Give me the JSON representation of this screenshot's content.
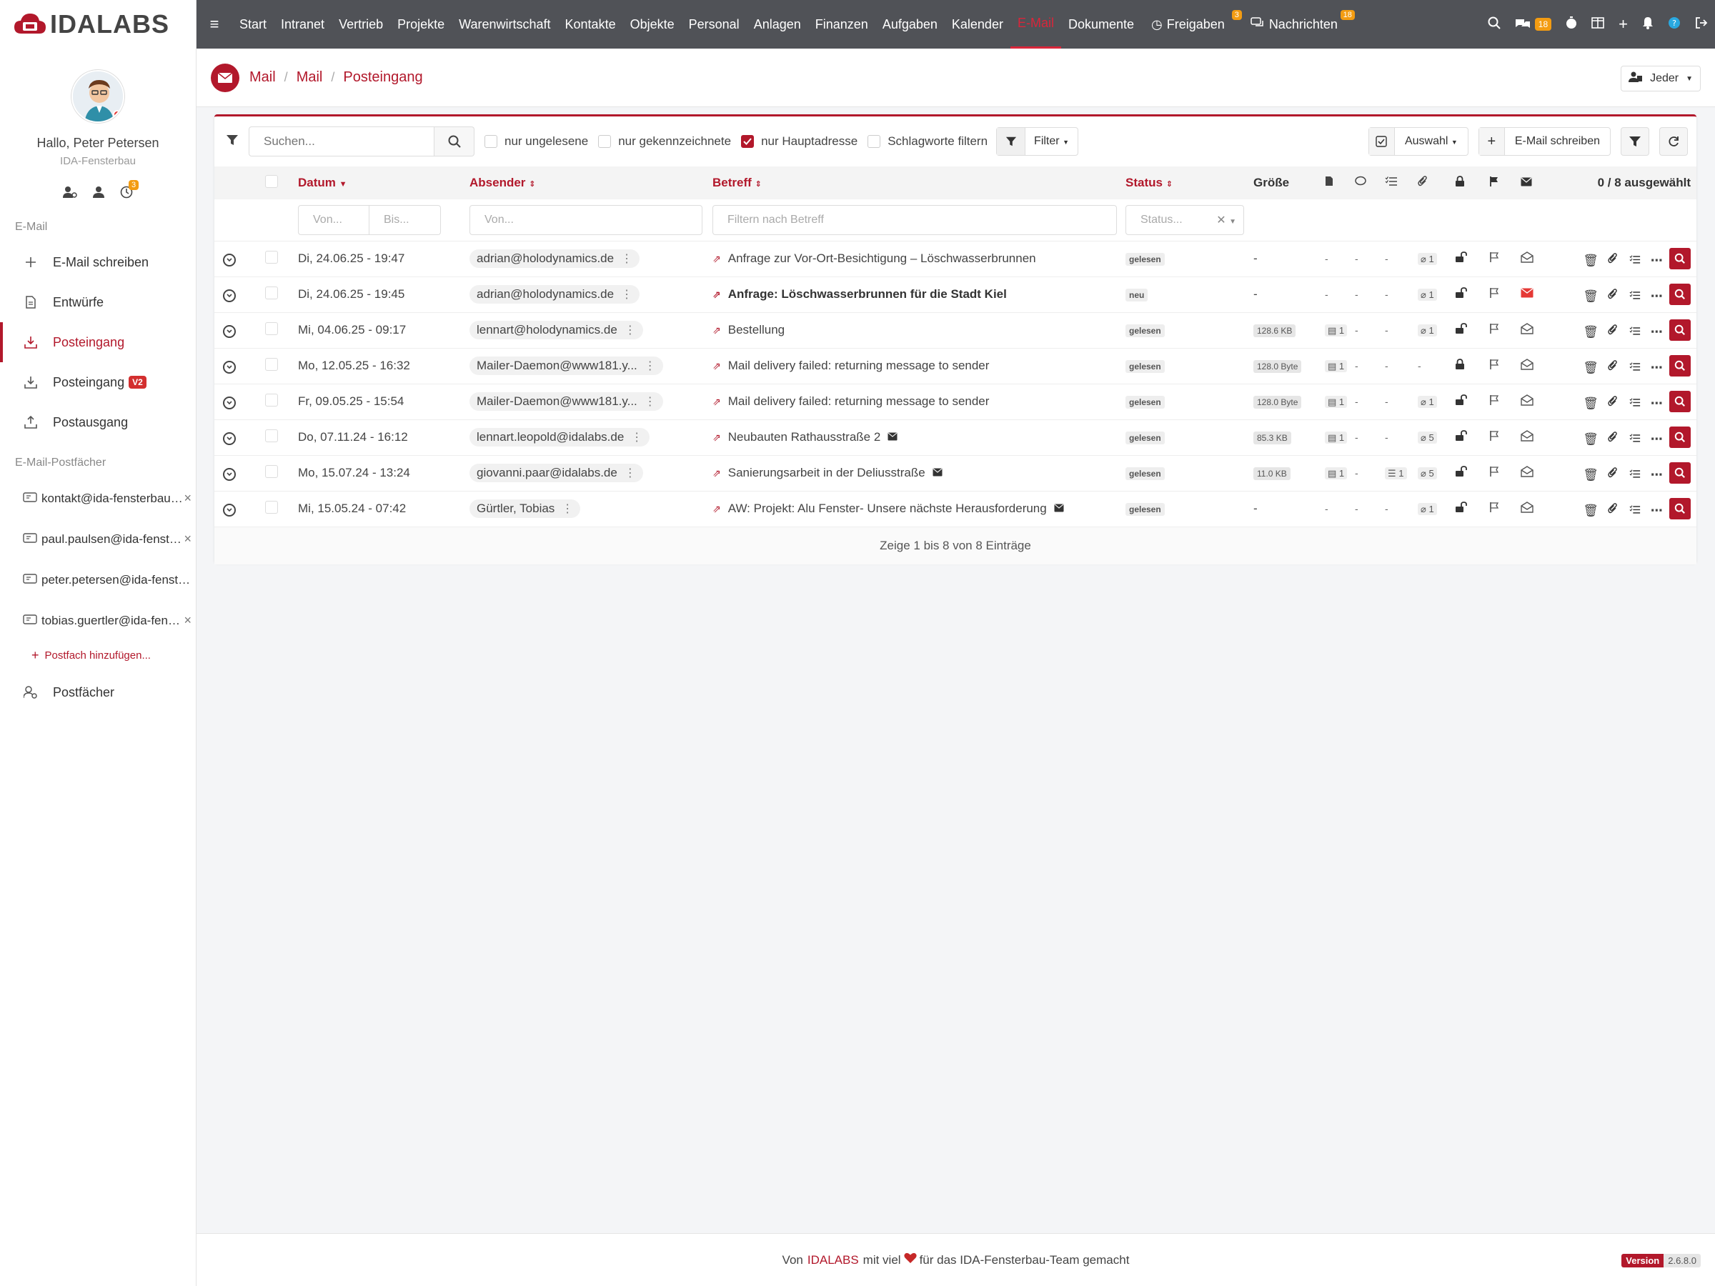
{
  "brand": {
    "name": "IDALABS"
  },
  "profile": {
    "greeting": "Hallo, Peter Petersen",
    "company": "IDA-Fensterbau",
    "notif_count": "3"
  },
  "sidebar": {
    "section_email": "E-Mail",
    "items": [
      {
        "label": "E-Mail schreiben"
      },
      {
        "label": "Entwürfe"
      },
      {
        "label": "Posteingang"
      },
      {
        "label": "Posteingang",
        "badge": "V2"
      },
      {
        "label": "Postausgang"
      }
    ],
    "section_mailboxes": "E-Mail-Postfächer",
    "mailboxes": [
      {
        "label": "kontakt@ida-fensterbau.de"
      },
      {
        "label": "paul.paulsen@ida-fensterbau.de"
      },
      {
        "label": "peter.petersen@ida-fensterbau.de"
      },
      {
        "label": "tobias.guertler@ida-fensterbau.de"
      }
    ],
    "add_mailbox": "Postfach hinzufügen...",
    "postfaecher": "Postfächer"
  },
  "nav": {
    "items": [
      "Start",
      "Intranet",
      "Vertrieb",
      "Projekte",
      "Warenwirtschaft",
      "Kontakte",
      "Objekte",
      "Personal",
      "Anlagen",
      "Finanzen",
      "Aufgaben",
      "Kalender",
      "E-Mail",
      "Dokumente"
    ],
    "freigaben": "Freigaben",
    "freigaben_badge": "3",
    "nachrichten": "Nachrichten",
    "nachrichten_badge": "18",
    "chat_badge": "18"
  },
  "breadcrumb": [
    "Mail",
    "Mail",
    "Posteingang"
  ],
  "jeder": "Jeder",
  "toolbar": {
    "search_placeholder": "Suchen...",
    "cb_unread": "nur ungelesene",
    "cb_flagged": "nur gekennzeichnete",
    "cb_main": "nur Hauptadresse",
    "cb_tags": "Schlagworte filtern",
    "filter": "Filter",
    "auswahl": "Auswahl",
    "compose": "E-Mail schreiben"
  },
  "table": {
    "headers": {
      "datum": "Datum",
      "absender": "Absender",
      "betreff": "Betreff",
      "status": "Status",
      "groesse": "Größe",
      "selected": "0 / 8 ausgewählt"
    },
    "filters": {
      "von": "Von...",
      "bis": "Bis...",
      "absender": "Von...",
      "betreff": "Filtern nach Betreff",
      "status": "Status..."
    },
    "rows": [
      {
        "date": "Di, 24.06.25 - 19:47",
        "sender": "adrian@holodynamics.de",
        "subject": "Anfrage zur Vor-Ort-Besichtigung – Löschwasserbrunnen",
        "status": "gelesen",
        "size": "-",
        "docs": "-",
        "comments": "-",
        "tasks": "-",
        "att": "1",
        "bold": false
      },
      {
        "date": "Di, 24.06.25 - 19:45",
        "sender": "adrian@holodynamics.de",
        "subject": "Anfrage: Löschwasserbrunnen für die Stadt Kiel",
        "status": "neu",
        "size": "-",
        "docs": "-",
        "comments": "-",
        "tasks": "-",
        "att": "1",
        "bold": true
      },
      {
        "date": "Mi, 04.06.25 - 09:17",
        "sender": "lennart@holodynamics.de",
        "subject": "Bestellung",
        "status": "gelesen",
        "size": "128.6 KB",
        "docs": "1",
        "comments": "-",
        "tasks": "-",
        "att": "1",
        "bold": false
      },
      {
        "date": "Mo, 12.05.25 - 16:32",
        "sender": "Mailer-Daemon@www181.y...",
        "subject": "Mail delivery failed: returning message to sender",
        "status": "gelesen",
        "size": "128.0 Byte",
        "docs": "1",
        "comments": "-",
        "tasks": "-",
        "att": "-",
        "bold": false
      },
      {
        "date": "Fr, 09.05.25 - 15:54",
        "sender": "Mailer-Daemon@www181.y...",
        "subject": "Mail delivery failed: returning message to sender",
        "status": "gelesen",
        "size": "128.0 Byte",
        "docs": "1",
        "comments": "-",
        "tasks": "-",
        "att": "1",
        "bold": false
      },
      {
        "date": "Do, 07.11.24 - 16:12",
        "sender": "lennart.leopold@idalabs.de",
        "subject": "Neubauten Rathausstraße 2",
        "status": "gelesen",
        "size": "85.3 KB",
        "docs": "1",
        "comments": "-",
        "tasks": "-",
        "att": "5",
        "bold": false
      },
      {
        "date": "Mo, 15.07.24 - 13:24",
        "sender": "giovanni.paar@idalabs.de",
        "subject": "Sanierungsarbeit in der Deliusstraße",
        "status": "gelesen",
        "size": "11.0 KB",
        "docs": "1",
        "comments": "-",
        "tasks": "1",
        "att": "5",
        "bold": false
      },
      {
        "date": "Mi, 15.05.24 - 07:42",
        "sender": "Gürtler, Tobias",
        "subject": "AW: Projekt: Alu Fenster- Unsere nächste Herausforderung",
        "status": "gelesen",
        "size": "-",
        "docs": "-",
        "comments": "-",
        "tasks": "-",
        "att": "1",
        "bold": false
      }
    ],
    "footer": "Zeige 1 bis 8 von 8 Einträge"
  },
  "pagefooter": {
    "pre": "Von",
    "brand": "IDALABS",
    "mid": "mit viel",
    "post": "für das IDA-Fensterbau-Team gemacht",
    "version_label": "Version",
    "version": "2.6.8.0"
  },
  "colors": {
    "accent": "#b2182b",
    "nav_bg": "#505257"
  }
}
